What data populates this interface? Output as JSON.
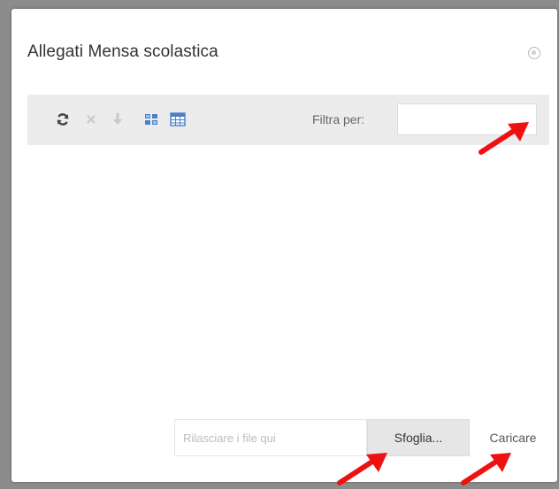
{
  "dialog": {
    "title": "Allegati Mensa scolastica",
    "close_icon": "close-circle-icon"
  },
  "toolbar": {
    "icons": [
      {
        "name": "refresh-icon",
        "color": "#444444"
      },
      {
        "name": "delete-icon",
        "color": "#c8c8c8"
      },
      {
        "name": "download-icon",
        "color": "#c8c8c8"
      },
      {
        "name": "grid-view-icon",
        "color": "#4a7fc7"
      },
      {
        "name": "table-view-icon",
        "color": "#4a7fc7"
      }
    ],
    "filter_label": "Filtra per:",
    "filter_value": ""
  },
  "upload": {
    "drop_placeholder": "Rilasciare i file qui",
    "browse_label": "Sfoglia...",
    "upload_label": "Caricare"
  },
  "annotation": {
    "arrow_color": "#ee1111"
  }
}
